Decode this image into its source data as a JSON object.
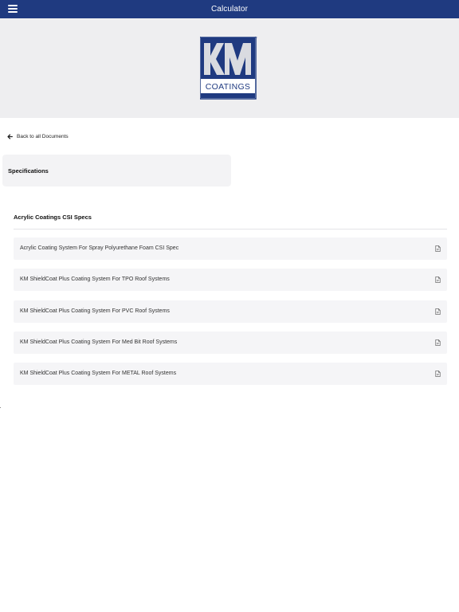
{
  "header": {
    "title": "Calculator",
    "menu_icon": "hamburger-menu-icon",
    "background": "#1f3a80"
  },
  "logo": {
    "letters": "KM",
    "wordmark": "COATINGS",
    "trademark": "™",
    "brand_color": "#1f3a80"
  },
  "nav": {
    "back_label": "Back to all Documents",
    "back_icon": "arrow-left-icon"
  },
  "specifications": {
    "title": "Specifications"
  },
  "section": {
    "title": "Acrylic Coatings CSI Specs"
  },
  "documents": [
    {
      "label": "Acrylic Coating System For Spray Polyurethane Foam CSI Spec",
      "icon": "pdf-file-icon"
    },
    {
      "label": "KM ShieldCoat Plus Coating System For TPO Roof Systems",
      "icon": "pdf-file-icon"
    },
    {
      "label": "KM ShieldCoat Plus Coating System For PVC Roof Systems",
      "icon": "pdf-file-icon"
    },
    {
      "label": "KM ShieldCoat Plus Coating System For Med Bit Roof Systems",
      "icon": "pdf-file-icon"
    },
    {
      "label": "KM ShieldCoat Plus Coating System For METAL Roof Systems",
      "icon": "pdf-file-icon"
    }
  ]
}
